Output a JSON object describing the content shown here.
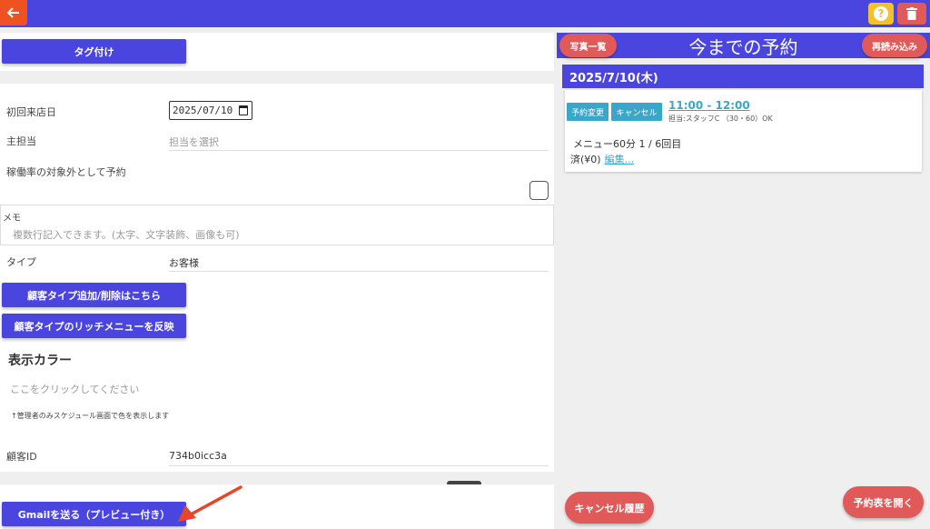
{
  "topbar": {
    "back_icon": "arrow-left-icon",
    "help_glyph": "?",
    "trash_icon": "trash-icon"
  },
  "left": {
    "tag_button": "タグ付け",
    "first_visit_label": "初回来店日",
    "first_visit_value": "2025/07/10",
    "main_staff_label": "主担当",
    "main_staff_placeholder": "担当を選択",
    "exclude_label": "稼働率の対象外として予約",
    "memo_label": "メモ",
    "memo_placeholder": "複数行記入できます。(太字、文字装飾、画像も可)",
    "type_label": "タイプ",
    "type_value": "お客様",
    "type_edit_button": "顧客タイプ追加/削除はこちら",
    "rich_menu_button": "顧客タイプのリッチメニューを反映",
    "color_title": "表示カラー",
    "color_placeholder": "ここをクリックしてください",
    "color_note": "↑管理者のみスケジュール画面で色を表示します",
    "customer_id_label": "顧客ID",
    "customer_id_value": "734b0icc3a",
    "gmail_button": "Gmailを送る（プレビュー付き）"
  },
  "right": {
    "title": "今までの予約",
    "photos_button": "写真一覧",
    "reload_button": "再読み込み",
    "date_header": "2025/7/10(木)",
    "reservation": {
      "change_button": "予約変更",
      "cancel_button": "キャンセル",
      "time": "11:00 - 12:00",
      "staff": "担当:スタッフC （30・60）OK",
      "menu": "メニュー60分 1 / 6回目",
      "paid": "済(¥0)",
      "edit_link": "編集..."
    },
    "cancel_history_button": "キャンセル履歴",
    "open_schedule_button": "予約表を開く"
  },
  "colors": {
    "primary": "#4b45e0",
    "danger": "#e05a5a",
    "warning": "#f2c12e",
    "accent": "#f0521f",
    "teal": "#3aa7c8"
  }
}
